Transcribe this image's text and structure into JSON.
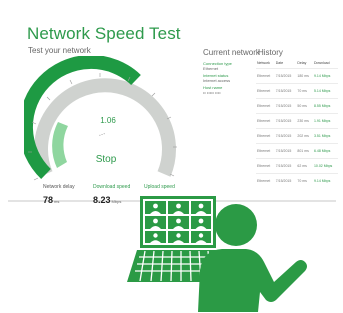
{
  "app": {
    "title": "Network Speed Test",
    "subtitle": "Test your network",
    "gauge_value": "1.06",
    "gauge_indicator": "...",
    "stop_label": "Stop"
  },
  "metrics": {
    "network_delay": {
      "label": "Network delay",
      "value": "78",
      "unit": "ms"
    },
    "download_speed": {
      "label": "Download speed",
      "value": "8.23",
      "unit": "Mbps"
    },
    "upload_speed": {
      "label": "Upload speed"
    }
  },
  "current_network": {
    "title": "Current network",
    "items": [
      {
        "label": "Connection type",
        "value": "Ethernet"
      },
      {
        "label": "Internet status",
        "value": "Internet access"
      },
      {
        "label": "Host name",
        "value": "•• ••••• ••••"
      }
    ]
  },
  "history": {
    "title": "History",
    "columns": [
      "Network",
      "Date",
      "Delay",
      "Download"
    ],
    "rows": [
      [
        "Ethernet",
        "7/15/2015",
        "180 ms",
        "9.14 Mbps"
      ],
      [
        "Ethernet",
        "7/15/2015",
        "70 ms",
        "5.14 Mbps"
      ],
      [
        "Ethernet",
        "7/15/2015",
        "50 ms",
        "8.55 Mbps"
      ],
      [
        "Ethernet",
        "7/15/2015",
        "230 ms",
        "1.91 Mbps"
      ],
      [
        "Ethernet",
        "7/15/2015",
        "202 ms",
        "3.51 Mbps"
      ],
      [
        "Ethernet",
        "7/15/2015",
        "801 ms",
        "6.48 Mbps"
      ],
      [
        "Ethernet",
        "7/15/2015",
        "62 ms",
        "10.02 Mbps"
      ],
      [
        "Ethernet",
        "7/15/2015",
        "70 ms",
        "9.14 Mbps"
      ]
    ]
  },
  "colors": {
    "accent": "#2e9a4c",
    "gauge_fill": "#1e9a43",
    "gauge_track": "#cfd2cf",
    "illustration": "#2b9a45"
  },
  "illustration_icons": [
    "presenter-icon",
    "laptop-video-call-icon"
  ]
}
